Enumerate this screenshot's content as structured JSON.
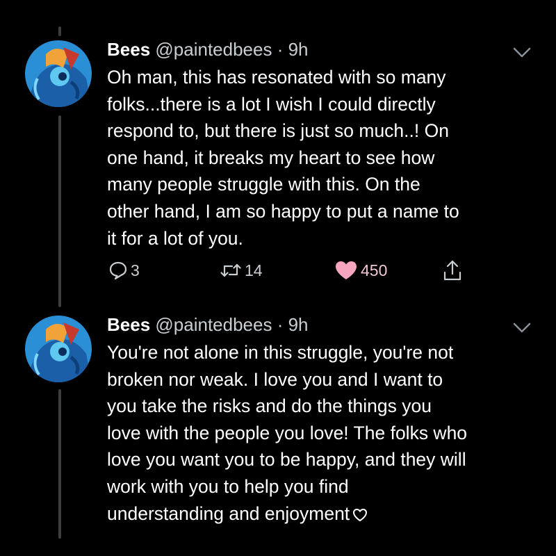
{
  "colors": {
    "background": "#000000",
    "text": "#ffffff",
    "secondary_text": "#c9ced3",
    "like_pink": "#f7a4be",
    "thread_line": "#3d3d3d"
  },
  "tweets": [
    {
      "author_name": "Bees",
      "handle": "@paintedbees",
      "separator": "·",
      "time": "9h",
      "avatar_icon": "avatar-icon",
      "menu_icon": "chevron-down-icon",
      "text": "Oh man, this has resonated with so many\nfolks...there is a lot I wish I could directly\nrespond to, but there is just so much..! On\none hand, it breaks my heart to see how\nmany people struggle with this. On the\nother hand, I am so happy to put a name to\nit for a lot of you.",
      "reply_count": "3",
      "retweet_count": "14",
      "like_count": "450",
      "liked": true
    },
    {
      "author_name": "Bees",
      "handle": "@paintedbees",
      "separator": "·",
      "time": "9h",
      "avatar_icon": "avatar-icon",
      "menu_icon": "chevron-down-icon",
      "text": "You're not alone in this struggle, you're not\nbroken nor weak. I love you and I want to\nyou take the risks and do the things you\nlove with the people you love! The folks who\nlove you want you to be happy, and they will\nwork with you to help you find\nunderstanding and enjoyment",
      "trailing_icon": "heart-outline-icon"
    }
  ]
}
